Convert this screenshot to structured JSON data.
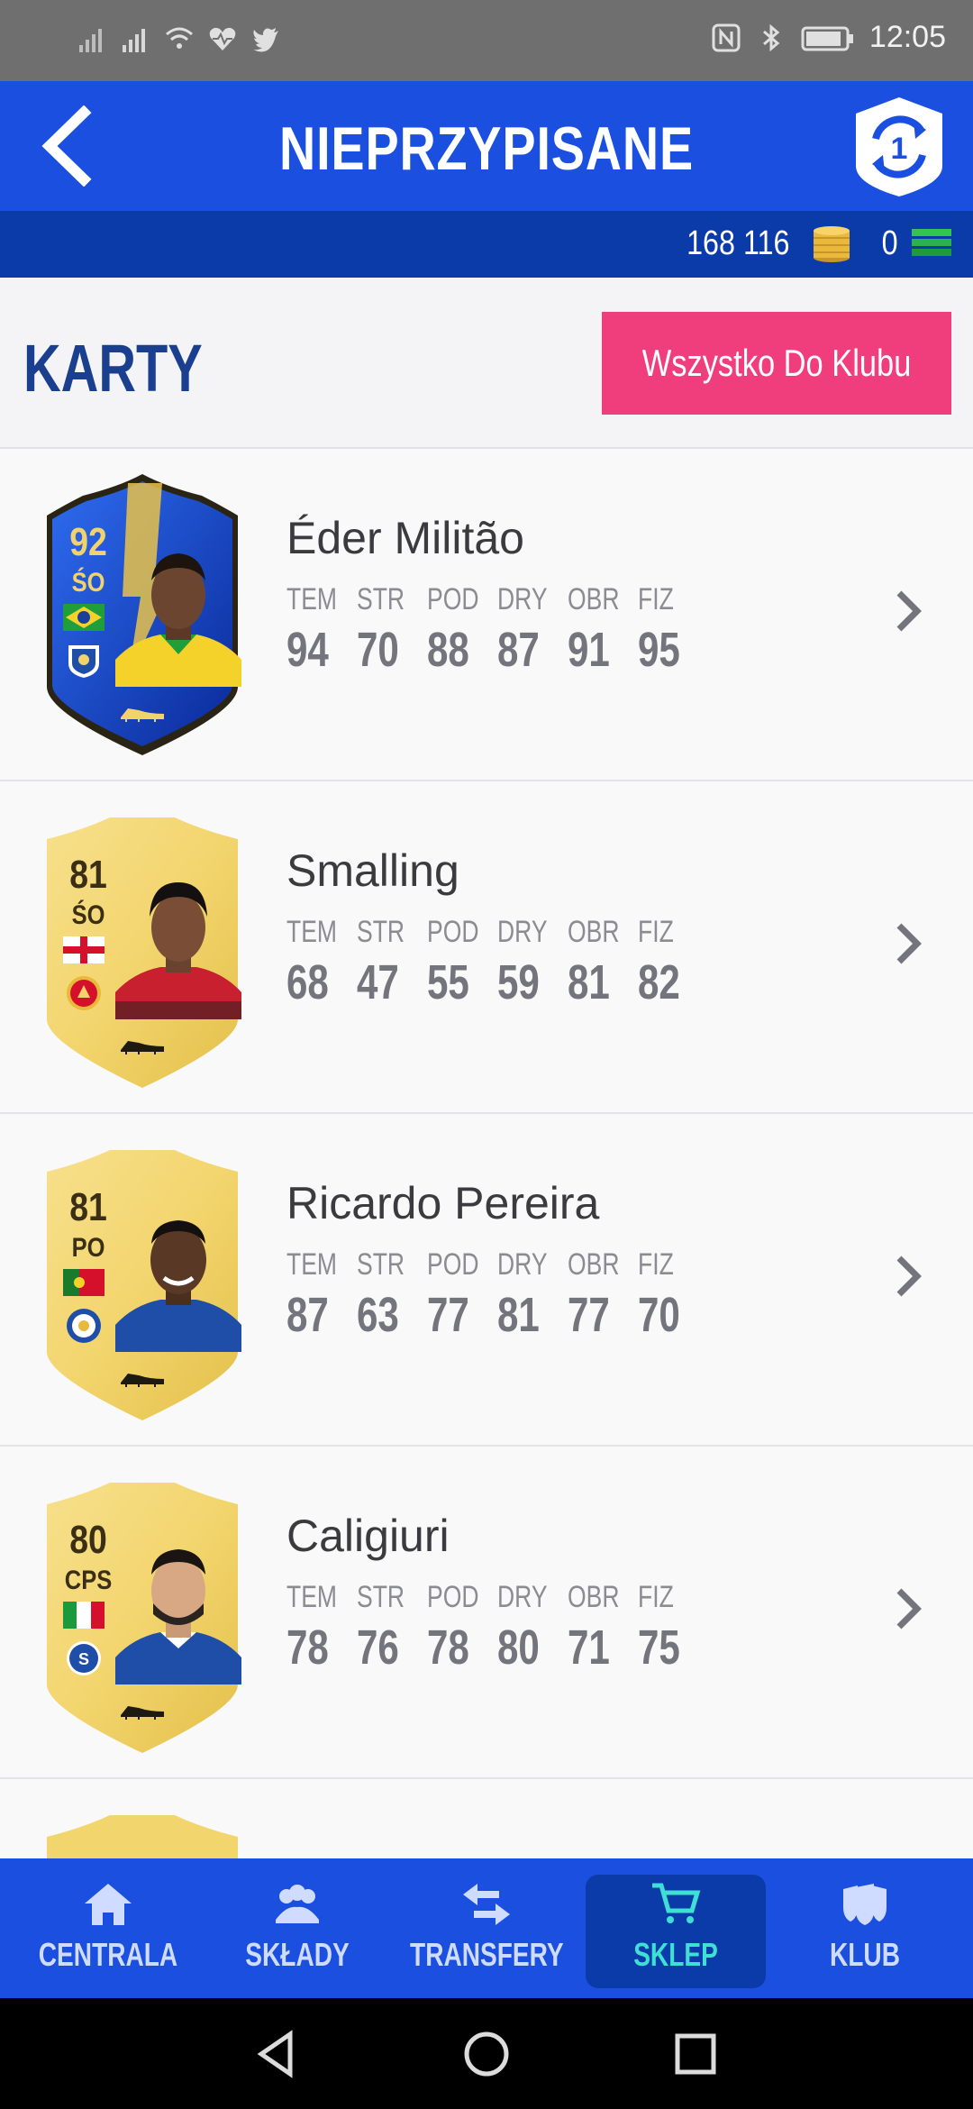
{
  "status_bar": {
    "time": "12:05",
    "left_icons": [
      "signal-icon",
      "signal-icon",
      "wifi-icon",
      "heart-rate-icon",
      "twitter-icon"
    ],
    "right_icons": [
      "nfc-icon",
      "bluetooth-icon",
      "battery-icon"
    ]
  },
  "header": {
    "title": "NIEPRZYPISANE",
    "back_icon": "back-arrow-icon",
    "badge_icon": "swap-badge-icon",
    "badge_number": "1"
  },
  "currency": {
    "coins": "168 116",
    "points": "0",
    "coin_color": "#e8b93a",
    "points_color": "#2bb24a"
  },
  "section": {
    "title": "KARTY",
    "all_to_club_label": "Wszystko Do Klubu"
  },
  "stat_labels": [
    "TEM",
    "STR",
    "POD",
    "DRY",
    "OBR",
    "FIZ"
  ],
  "players": [
    {
      "name": "Éder Militão",
      "rating": "92",
      "position": "ŚO",
      "card_type": "toty",
      "nation": "brazil-flag",
      "club": "porto-crest",
      "stats": [
        "94",
        "70",
        "88",
        "87",
        "91",
        "95"
      ]
    },
    {
      "name": "Smalling",
      "rating": "81",
      "position": "ŚO",
      "card_type": "gold",
      "nation": "england-flag",
      "club": "manchester-united-crest",
      "stats": [
        "68",
        "47",
        "55",
        "59",
        "81",
        "82"
      ]
    },
    {
      "name": "Ricardo Pereira",
      "rating": "81",
      "position": "PO",
      "card_type": "gold",
      "nation": "portugal-flag",
      "club": "leicester-crest",
      "stats": [
        "87",
        "63",
        "77",
        "81",
        "77",
        "70"
      ]
    },
    {
      "name": "Caligiuri",
      "rating": "80",
      "position": "CPS",
      "card_type": "gold",
      "nation": "italy-flag",
      "club": "schalke-crest",
      "stats": [
        "78",
        "76",
        "78",
        "80",
        "71",
        "75"
      ]
    }
  ],
  "bottom_nav": [
    {
      "label": "CENTRALA",
      "icon": "home-icon",
      "active": false
    },
    {
      "label": "SKŁADY",
      "icon": "squad-icon",
      "active": false
    },
    {
      "label": "TRANSFERY",
      "icon": "transfer-arrows-icon",
      "active": false
    },
    {
      "label": "SKLEP",
      "icon": "cart-icon",
      "active": true
    },
    {
      "label": "KLUB",
      "icon": "club-icon",
      "active": false
    }
  ],
  "colors": {
    "primary_blue": "#1a4fe0",
    "dark_blue": "#0b3ba8",
    "pink_button": "#f03e7c",
    "active_nav_text": "#3ee0d4"
  }
}
